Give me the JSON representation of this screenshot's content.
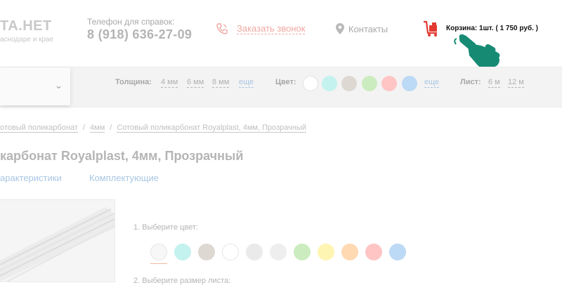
{
  "header": {
    "logo": "TA.HET",
    "logo_sub": "аснодаре и крае",
    "phone_label": "Телефон для справок:",
    "phone": "8 (918) 636-27-09",
    "callback_label": "Заказать звонок",
    "contacts_label": "Контакты",
    "cart_label": "Корзина: 1шт. ( 1 750 руб. )",
    "icons": [
      "phone-icon",
      "location-pin-icon",
      "cart-icon",
      "hand-pointer-icon"
    ],
    "accent_color": "#f0a8a2",
    "pointer_color": "#178a74"
  },
  "filters": {
    "thickness_label": "Толщина:",
    "thickness_options": [
      "4 мм",
      "6 мм",
      "8 мм"
    ],
    "thickness_more": "еще",
    "color_label": "Цвет:",
    "colors": [
      "#ffffff",
      "#c4f2ee",
      "#ddd8d2",
      "#cbecbf",
      "#ffc4c4",
      "#bcd9f5"
    ],
    "color_more": "еще",
    "sheet_label": "Лист:",
    "sheet_options": [
      "6 м",
      "12 м"
    ]
  },
  "breadcrumb": [
    "отовый поликарбонат",
    "4мм",
    "Сотовый поликарбонат Royalplast, 4мм, Прозрачный"
  ],
  "product": {
    "title": "карбонат Royalplast, 4мм, Прозрачный",
    "tabs": [
      "арактеристики",
      "Комплектующие"
    ],
    "step1_label": "1. Выберите цвет:",
    "step2_label": "2. Выберите размер листа:",
    "color_choices": [
      "#f7f7f7",
      "#c4f2ee",
      "#ddd8d2",
      "#ffffff",
      "#eaeaea",
      "#eeeeee",
      "#cbecbf",
      "#fff5b2",
      "#fed9b2",
      "#ffc4c4",
      "#bcd9f5"
    ]
  }
}
